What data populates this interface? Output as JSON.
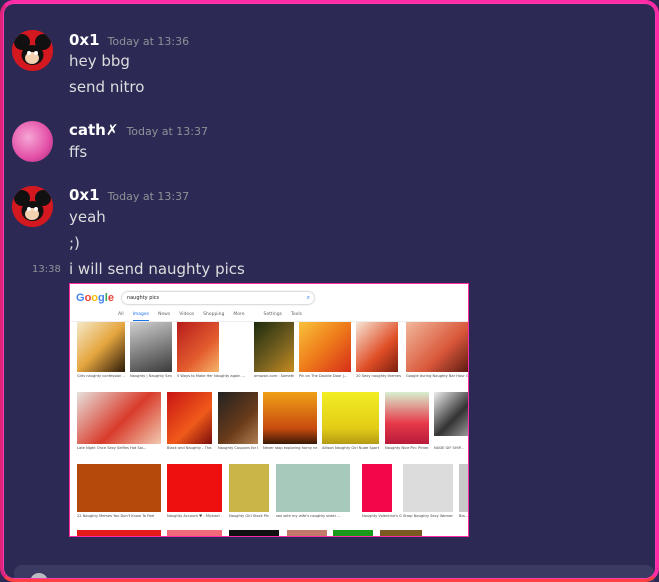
{
  "messages": [
    {
      "username": "0x1",
      "timestamp": "Today at 13:36",
      "lines": [
        "hey bbg",
        "send nitro"
      ]
    },
    {
      "username": "cath✗",
      "timestamp": "Today at 13:37",
      "lines": [
        "ffs"
      ]
    },
    {
      "username": "0x1",
      "timestamp": "Today at 13:37",
      "lines": [
        "yeah",
        ";)"
      ]
    }
  ],
  "followup": {
    "timestamp": "13:38",
    "text": "i will send naughty pics"
  },
  "attachment": {
    "search_query": "naughty pics",
    "tabs": [
      "All",
      "Images",
      "News",
      "Videos",
      "Shopping",
      "More",
      "Settings",
      "Tools"
    ],
    "active_tab": "Images",
    "row1_captions": [
      "Girls naughty confession ...",
      "Naughty | Naughty Sen...",
      "5 Ways to Make Her Naughty again ...",
      "amazon.com : Someth...",
      "Pin on The Double Door |...",
      "20 Sexy naughty themes ...",
      "Google during Naughty Bar Hour Guide"
    ],
    "row2_captions": [
      "Late Night Once Sexy Selfies Hot Sol...",
      "Black and Naughty - The...",
      "Naughty Coupons for H...",
      "Never stop exploring horny nes...",
      "Allison Naughty Girl Nude Sports ...",
      "Naughty Nice Pin: Pinter...",
      "NUDE GIF SHIP..."
    ],
    "row3_captions": [
      "22 Naughty Memes You Don't Know To Feel",
      "Naughty Account ♥ - Michael ...",
      "Naughty Girl Stock Pho...",
      "sex with my wife's naughty sister ...",
      "Naughty Valentine's Ga...",
      "Strop Naughty Sexy Women...",
      "Bla..."
    ],
    "logo_colors": [
      "#4285f4",
      "#ea4335",
      "#fbbc05",
      "#4285f4",
      "#34a853",
      "#ea4335"
    ],
    "logo_text": "Google"
  }
}
